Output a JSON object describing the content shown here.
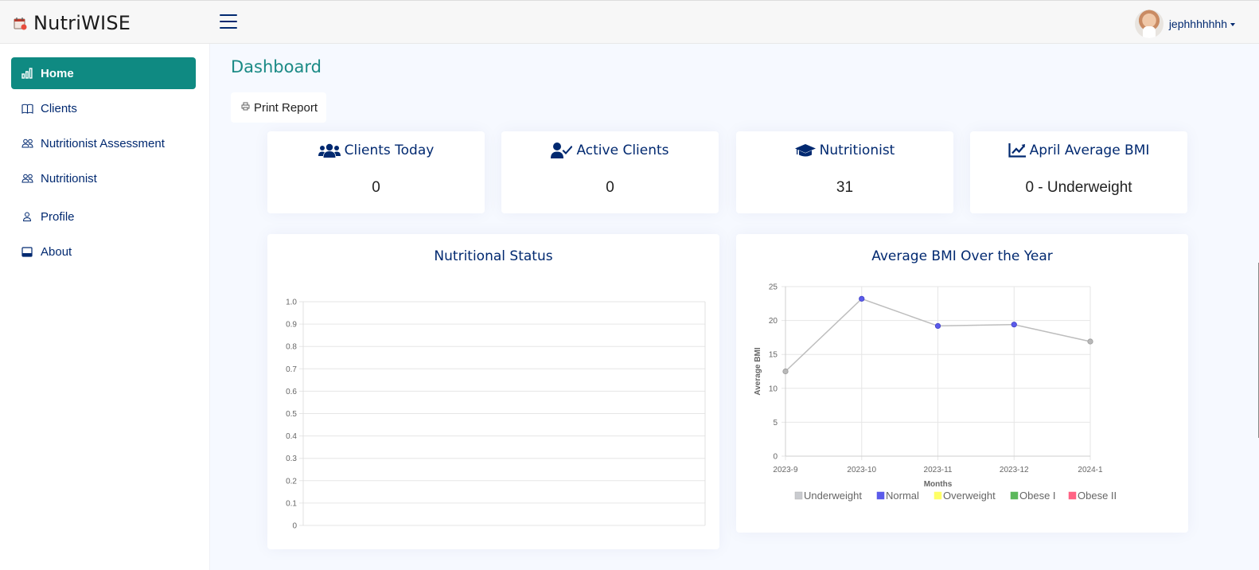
{
  "header": {
    "app_name": "NutriWISE",
    "username": "jephhhhhhh"
  },
  "sidebar": {
    "items": [
      {
        "label": "Home",
        "icon": "bar-chart-icon"
      },
      {
        "label": "Clients",
        "icon": "book-icon"
      },
      {
        "label": "Nutritionist Assessment",
        "icon": "people-icon"
      },
      {
        "label": "Nutritionist",
        "icon": "people-icon"
      },
      {
        "label": "Profile",
        "icon": "person-icon"
      },
      {
        "label": "About",
        "icon": "window-icon"
      }
    ]
  },
  "main": {
    "title": "Dashboard",
    "print_label": "Print Report"
  },
  "stats": [
    {
      "label": "Clients Today",
      "value": "0",
      "icon": "users-icon"
    },
    {
      "label": "Active Clients",
      "value": "0",
      "icon": "user-check-icon"
    },
    {
      "label": "Nutritionist",
      "value": "31",
      "icon": "graduation-cap-icon"
    },
    {
      "label": "April Average BMI",
      "value": "0 - Underweight",
      "icon": "chart-line-icon"
    }
  ],
  "colors": {
    "accent": "#0f8a82",
    "navy": "#012970",
    "underweight": "#c9cbcf",
    "normal": "#5b5bea",
    "overweight": "#ffff66",
    "obese1": "#5cb85c",
    "obese2": "#ff6384"
  },
  "chart_data": [
    {
      "type": "bar",
      "title": "Nutritional Status",
      "categories": [],
      "values": [],
      "xlabel": "",
      "ylabel": "",
      "ylim": [
        0,
        1.0
      ],
      "yticks": [
        "1.0",
        "0.9",
        "0.8",
        "0.7",
        "0.6",
        "0.5",
        "0.4",
        "0.3",
        "0.2",
        "0.1",
        "0"
      ],
      "grid": true
    },
    {
      "type": "line",
      "title": "Average BMI Over the Year",
      "x": [
        "2023-9",
        "2023-10",
        "2023-11",
        "2023-12",
        "2024-1"
      ],
      "values": [
        12.5,
        23.2,
        19.2,
        19.4,
        16.9
      ],
      "point_status": [
        "Underweight",
        "Normal",
        "Normal",
        "Normal",
        "Underweight"
      ],
      "xlabel": "Months",
      "ylabel": "Average BMI",
      "ylim": [
        0,
        25
      ],
      "yticks": [
        "25",
        "20",
        "15",
        "10",
        "5",
        "0"
      ],
      "grid": true,
      "legend": [
        "Underweight",
        "Normal",
        "Overweight",
        "Obese I",
        "Obese II"
      ],
      "legend_position": "bottom"
    }
  ]
}
